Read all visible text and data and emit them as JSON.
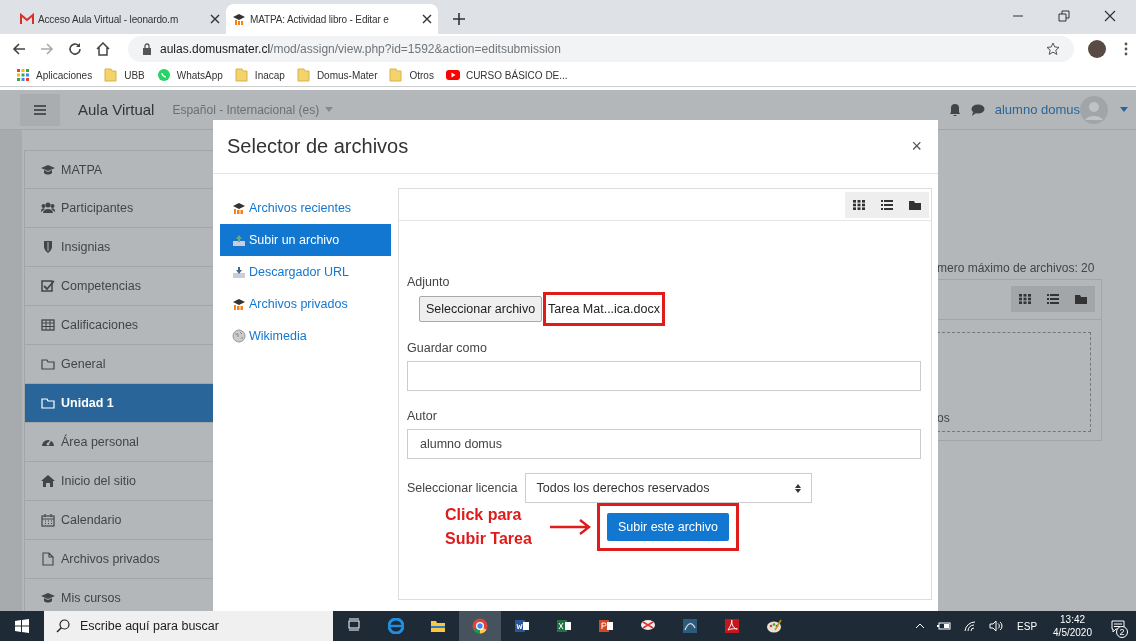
{
  "browser": {
    "tabs": [
      {
        "title": "Acceso Aula Virtual - leonardo.m",
        "selected": false
      },
      {
        "title": "MATPA: Actividad libro - Editar e",
        "selected": true
      }
    ],
    "url": {
      "host": "aulas.domusmater.cl",
      "path": "/mod/assign/view.php?id=1592&action=editsubmission"
    },
    "bookmarks": [
      {
        "label": "Aplicaciones"
      },
      {
        "label": "UBB"
      },
      {
        "label": "WhatsApp"
      },
      {
        "label": "Inacap"
      },
      {
        "label": "Domus-Mater"
      },
      {
        "label": "Otros"
      },
      {
        "label": "CURSO BÁSICO DE..."
      }
    ]
  },
  "navbar": {
    "site_name": "Aula Virtual",
    "language": "Español - Internacional (es)",
    "user": "alumno domus"
  },
  "drawer": [
    {
      "label": "MATPA",
      "selected": false
    },
    {
      "label": "Participantes",
      "selected": false
    },
    {
      "label": "Insignias",
      "selected": false
    },
    {
      "label": "Competencias",
      "selected": false
    },
    {
      "label": "Calificaciones",
      "selected": false
    },
    {
      "label": "General",
      "selected": false
    },
    {
      "label": "Unidad 1",
      "selected": true
    },
    {
      "label": "Área personal",
      "selected": false
    },
    {
      "label": "Inicio del sitio",
      "selected": false
    },
    {
      "label": "Calendario",
      "selected": false
    },
    {
      "label": "Archivos privados",
      "selected": false
    },
    {
      "label": "Mis cursos",
      "selected": false
    }
  ],
  "course": {
    "max_files": "mero máximo de archivos: 20",
    "dropzone_text": "os"
  },
  "modal": {
    "title": "Selector de archivos",
    "close": "×",
    "sources": [
      {
        "label": "Archivos recientes",
        "selected": false
      },
      {
        "label": "Subir un archivo",
        "selected": true
      },
      {
        "label": "Descargador URL",
        "selected": false
      },
      {
        "label": "Archivos privados",
        "selected": false
      },
      {
        "label": "Wikimedia",
        "selected": false
      }
    ],
    "form": {
      "attachment_label": "Adjunto",
      "choose_button": "Seleccionar archivo",
      "file_name": "Tarea Mat...ica.docx",
      "file_name_highlighted": true,
      "save_as_label": "Guardar como",
      "author_label": "Autor",
      "author_value": "alumno domus",
      "license_label": "Seleccionar licencia",
      "license_value": "Todos los derechos reservados",
      "submit_button": "Subir este archivo",
      "submit_highlighted": true
    }
  },
  "annotation": {
    "text": "Click para Subir Tarea"
  },
  "taskbar": {
    "search_placeholder": "Escribe aquí para buscar",
    "apps": [
      {
        "selected": false
      },
      {
        "selected": false
      },
      {
        "selected": false
      },
      {
        "selected": true
      },
      {
        "selected": false
      },
      {
        "selected": false
      },
      {
        "selected": false
      },
      {
        "selected": false
      },
      {
        "selected": false
      },
      {
        "selected": false
      },
      {
        "selected": false
      }
    ],
    "language": "ESP",
    "time": "13:42",
    "date": "4/5/2020",
    "notifications": "2"
  }
}
